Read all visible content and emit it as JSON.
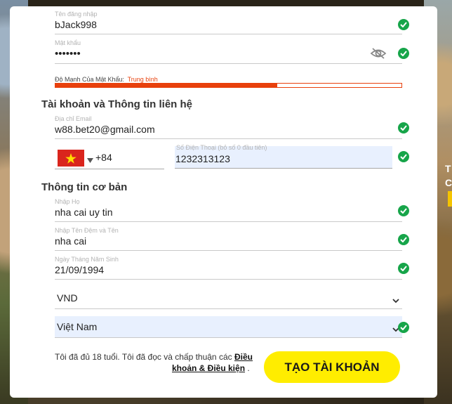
{
  "username": {
    "label": "Tên đăng nhập",
    "value": "bJack998"
  },
  "password": {
    "label": "Mật khẩu",
    "value": "•••••••"
  },
  "strength": {
    "label": "Độ Mạnh Của Mật Khẩu:",
    "level": "Trung bình",
    "fill_fraction": 0.64,
    "color": "#e8400c"
  },
  "section_contact": "Tài khoản và Thông tin liên hệ",
  "email": {
    "label": "Địa chỉ Email",
    "value": "w88.bet20@gmail.com"
  },
  "phone": {
    "country_code": "+84",
    "label": "Số Điện Thoại (bỏ số 0 đầu tiên)",
    "value": "1232313123",
    "flag": "vietnam-flag-icon"
  },
  "section_basic": "Thông tin cơ bản",
  "last_name": {
    "label": "Nhập Họ",
    "value": "nha cai uy tin"
  },
  "first_name": {
    "label": "Nhập Tên Đệm và Tên",
    "value": "nha cai"
  },
  "birthdate": {
    "label": "Ngày Tháng Năm Sinh",
    "value": "21/09/1994"
  },
  "currency": {
    "value": "VND"
  },
  "country": {
    "value": "Việt Nam"
  },
  "terms": {
    "text": "Tôi đã đủ 18 tuổi. Tôi đã đọc và chấp thuận các",
    "link_part1": "Điều",
    "link_part2": "khoản & Điều kiện",
    "period": "."
  },
  "submit_label": "TẠO TÀI KHOẢN",
  "colors": {
    "valid": "#17a54a",
    "accent": "#ffed00",
    "input_highlight": "#e8f0fe"
  }
}
